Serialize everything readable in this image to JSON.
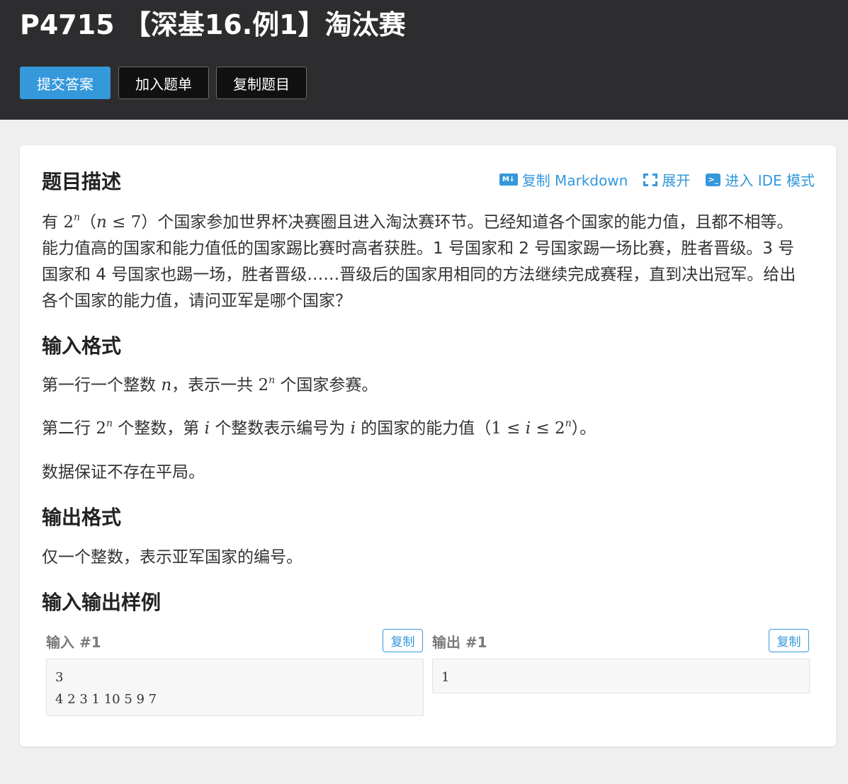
{
  "header": {
    "title": "P4715 【深基16.例1】淘汰赛",
    "submit_label": "提交答案",
    "add_label": "加入题单",
    "copy_problem_label": "复制题目"
  },
  "tools": {
    "copy_markdown": "复制 Markdown",
    "expand": "展开",
    "ide": "进入 IDE 模式",
    "md_icon_text": "M↓",
    "term_icon_text": ">_"
  },
  "description": {
    "heading": "题目描述",
    "t1": "有 ",
    "m_base": "2",
    "m_exp": "n",
    "t2": "（",
    "m_n": "n",
    "m_le7": " ≤ 7",
    "t3": "）个国家参加世界杯决赛圈且进入淘汰赛环节。已经知道各个国家的能力值，且都不相等。能力值高的国家和能力值低的国家踢比赛时高者获胜。1 号国家和 2 号国家踢一场比赛，胜者晋级。3 号国家和 4 号国家也踢一场，胜者晋级……晋级后的国家用相同的方法继续完成赛程，直到决出冠军。给出各个国家的能力值，请问亚军是哪个国家？"
  },
  "input_format": {
    "heading": "输入格式",
    "l1_a": "第一行一个整数 ",
    "l1_n": "n",
    "l1_b": "，表示一共 ",
    "l1_base": "2",
    "l1_exp": "n",
    "l1_c": " 个国家参赛。",
    "l2_a": "第二行 ",
    "l2_base": "2",
    "l2_exp": "n",
    "l2_b": " 个整数，第 ",
    "l2_i": "i",
    "l2_c": " 个整数表示编号为 ",
    "l2_i2": "i",
    "l2_d": " 的国家的能力值（",
    "l2_m1": "1 ≤ ",
    "l2_mi": "i",
    "l2_m2": " ≤ 2",
    "l2_mexp": "n",
    "l2_e": "）。",
    "l3": "数据保证不存在平局。"
  },
  "output_format": {
    "heading": "输出格式",
    "text": "仅一个整数，表示亚军国家的编号。"
  },
  "samples": {
    "heading": "输入输出样例",
    "input_label": "输入 #1",
    "output_label": "输出 #1",
    "copy_label": "复制",
    "input_text": "3\n4 2 3 1 10 5 9 7",
    "output_text": "1"
  }
}
